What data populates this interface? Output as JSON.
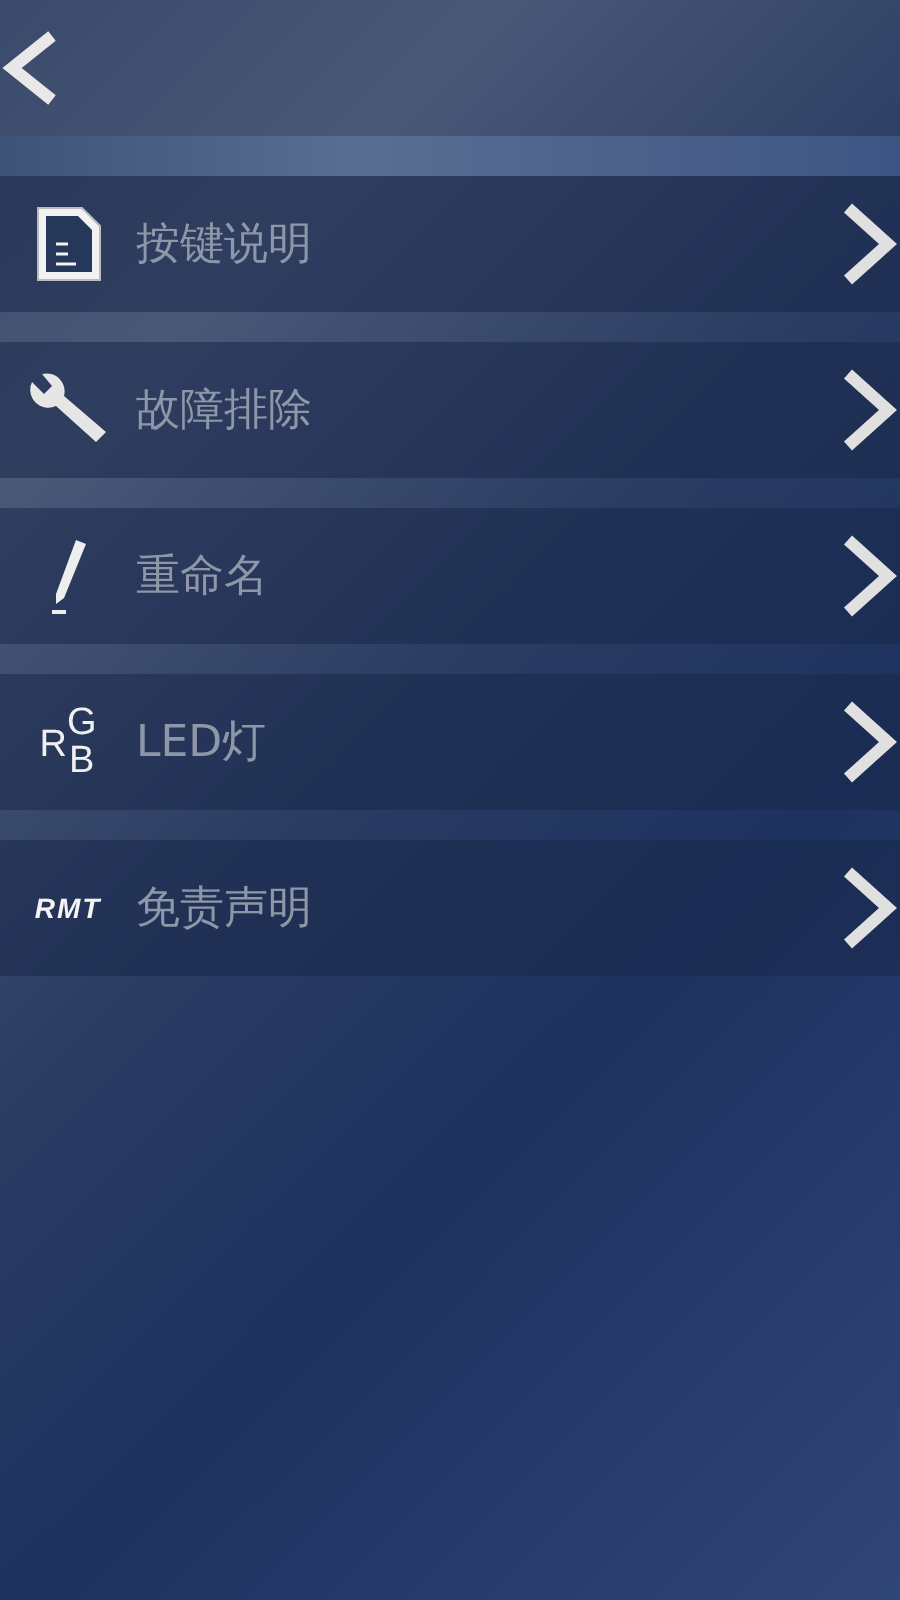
{
  "menu": [
    {
      "kind": "doc",
      "label": "按键说明"
    },
    {
      "kind": "wrench",
      "label": "故障排除"
    },
    {
      "kind": "pencil",
      "label": "重命名"
    },
    {
      "kind": "rgb",
      "label": "LED灯",
      "icon_letters": [
        "R",
        "G",
        "B"
      ]
    },
    {
      "kind": "logo",
      "label": "免责声明",
      "logo_text": "RMT"
    }
  ]
}
